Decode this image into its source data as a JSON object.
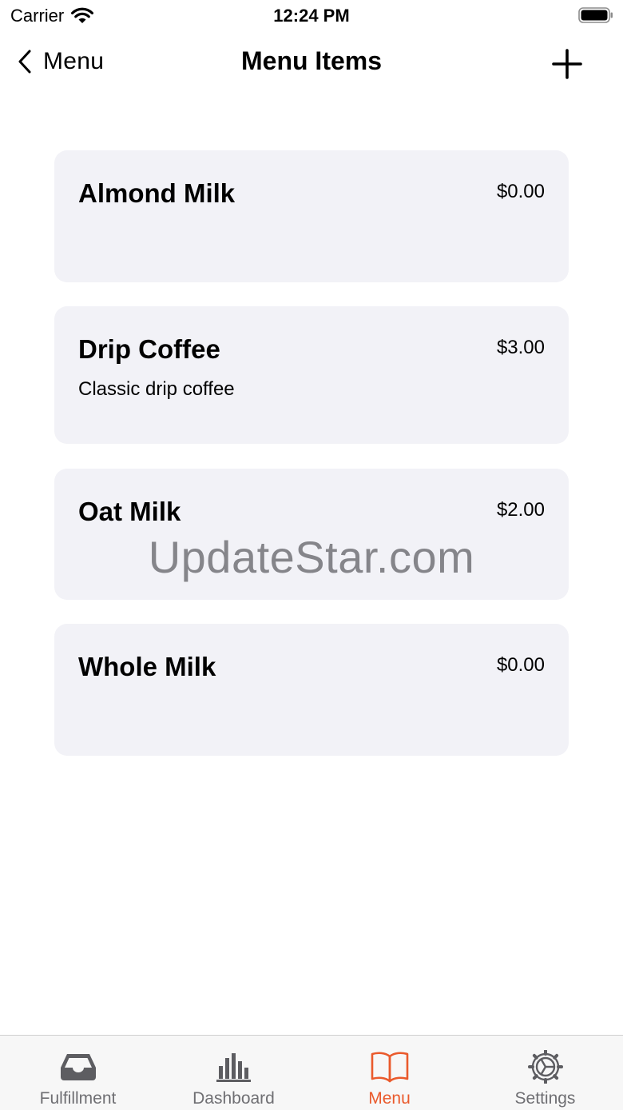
{
  "status_bar": {
    "carrier": "Carrier",
    "time": "12:24 PM"
  },
  "nav": {
    "back_label": "Menu",
    "title": "Menu Items"
  },
  "items": [
    {
      "name": "Almond Milk",
      "price": "$0.00",
      "description": ""
    },
    {
      "name": "Drip Coffee",
      "price": "$3.00",
      "description": "Classic drip coffee"
    },
    {
      "name": "Oat Milk",
      "price": "$2.00",
      "description": ""
    },
    {
      "name": "Whole Milk",
      "price": "$0.00",
      "description": ""
    }
  ],
  "watermark": "UpdateStar.com",
  "tabs": [
    {
      "label": "Fulfillment",
      "icon": "inbox-tray-icon"
    },
    {
      "label": "Dashboard",
      "icon": "bar-chart-icon"
    },
    {
      "label": "Menu",
      "icon": "open-book-icon",
      "active": true
    },
    {
      "label": "Settings",
      "icon": "gear-icon"
    }
  ],
  "colors": {
    "accent": "#ea5a2c",
    "card_background": "#f2f2f7",
    "tab_inactive": "#6f6f73"
  }
}
